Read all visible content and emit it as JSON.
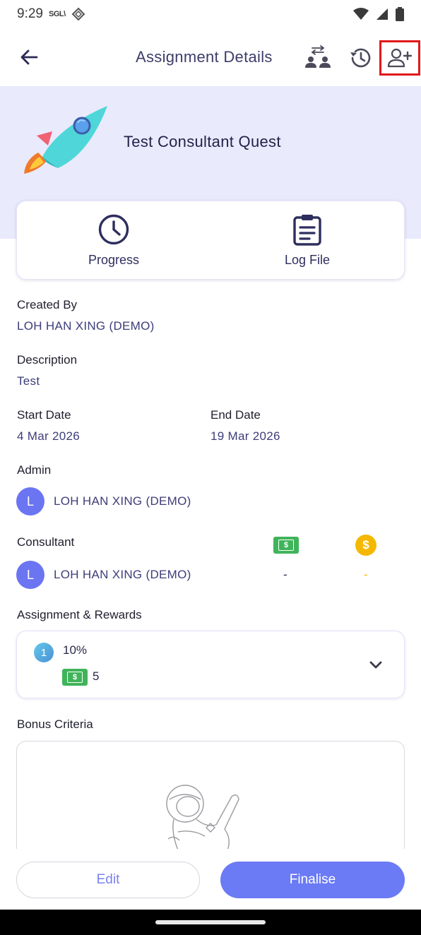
{
  "status_bar": {
    "time": "9:29",
    "carrier": "SGL\\"
  },
  "app_bar": {
    "title": "Assignment Details"
  },
  "quest": {
    "title": "Test Consultant Quest"
  },
  "tabs": [
    {
      "label": "Progress",
      "icon": "clock-icon"
    },
    {
      "label": "Log File",
      "icon": "clipboard-icon"
    }
  ],
  "created_by": {
    "label": "Created By",
    "value": "LOH HAN XING (DEMO)"
  },
  "description": {
    "label": "Description",
    "value": "Test"
  },
  "start_date": {
    "label": "Start Date",
    "value": "4 Mar 2026"
  },
  "end_date": {
    "label": "End Date",
    "value": "19 Mar 2026"
  },
  "admin": {
    "label": "Admin",
    "avatar_initial": "L",
    "name": "LOH HAN XING (DEMO)"
  },
  "consultant": {
    "label": "Consultant",
    "avatar_initial": "L",
    "name": "LOH HAN XING (DEMO)",
    "cash_value": "-",
    "coin_value": "-"
  },
  "rewards": {
    "label": "Assignment & Rewards",
    "items": [
      {
        "rank": "1",
        "percent": "10%",
        "amount": "5"
      }
    ]
  },
  "bonus": {
    "label": "Bonus Criteria"
  },
  "actions": {
    "edit": "Edit",
    "finalise": "Finalise"
  },
  "colors": {
    "accent": "#6b7af5",
    "hero_bg": "#e9eafc",
    "money_green": "#3fb45a",
    "coin_gold": "#f5b800",
    "highlight_red": "#e0191b"
  }
}
